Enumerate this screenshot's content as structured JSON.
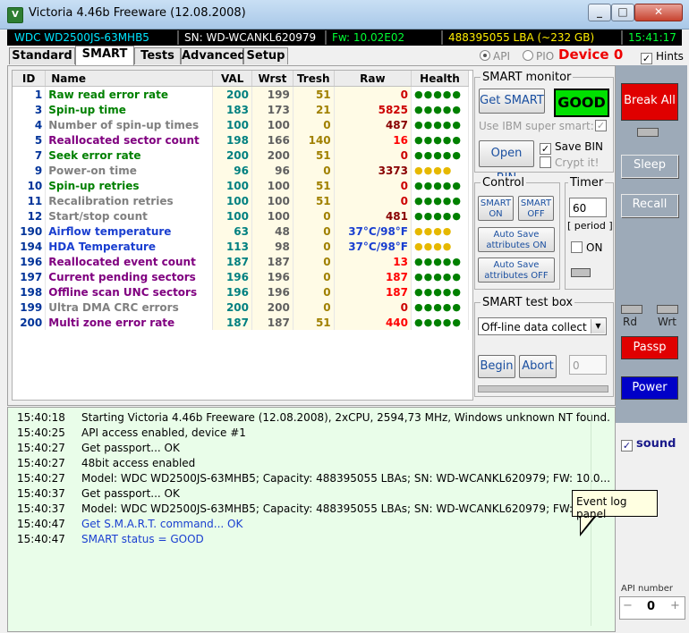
{
  "window": {
    "title": "Victoria 4.46b Freeware (12.08.2008)",
    "minimize": "_",
    "maximize": "□",
    "close": "✕"
  },
  "infobar": {
    "model": "WDC WD2500JS-63MHB5",
    "serial": "SN: WD-WCANKL620979",
    "firmware": "Fw: 10.02E02",
    "lba": "488395055 LBA (~232 GB)",
    "clock": "15:41:17",
    "colors": {
      "model": "#00e5ff",
      "serial": "#ffffff",
      "firmware": "#00ff33",
      "lba": "#ffee00",
      "clock": "#00ff33"
    }
  },
  "tabs": [
    "Standard",
    "SMART",
    "Tests",
    "Advanced",
    "Setup"
  ],
  "mode": {
    "api_label": "API",
    "pio_label": "PIO",
    "device": "Device 0",
    "hints_label": "Hints"
  },
  "smart_table": {
    "headers": [
      "ID",
      "Name",
      "VAL",
      "Wrst",
      "Tresh",
      "Raw",
      "Health"
    ],
    "rows": [
      {
        "id": "1",
        "name": "Raw read error rate",
        "val": "200",
        "wrst": "199",
        "tresh": "51",
        "raw": "0",
        "health": "●●●●●",
        "name_color": "#008000",
        "raw_color": "#cc0000",
        "health_color": "#008000"
      },
      {
        "id": "3",
        "name": "Spin-up time",
        "val": "183",
        "wrst": "173",
        "tresh": "21",
        "raw": "5825",
        "health": "●●●●●",
        "name_color": "#008000",
        "raw_color": "#cc0000",
        "health_color": "#008000"
      },
      {
        "id": "4",
        "name": "Number of spin-up times",
        "val": "100",
        "wrst": "100",
        "tresh": "0",
        "raw": "487",
        "health": "●●●●●",
        "name_color": "#808080",
        "raw_color": "#880000",
        "health_color": "#008000"
      },
      {
        "id": "5",
        "name": "Reallocated sector count",
        "val": "198",
        "wrst": "166",
        "tresh": "140",
        "raw": "16",
        "health": "●●●●●",
        "name_color": "#800080",
        "raw_color": "#ff0000",
        "health_color": "#008000"
      },
      {
        "id": "7",
        "name": "Seek error rate",
        "val": "200",
        "wrst": "200",
        "tresh": "51",
        "raw": "0",
        "health": "●●●●●",
        "name_color": "#008000",
        "raw_color": "#cc0000",
        "health_color": "#008000"
      },
      {
        "id": "9",
        "name": "Power-on time",
        "val": "96",
        "wrst": "96",
        "tresh": "0",
        "raw": "3373",
        "health": "●●●●",
        "name_color": "#808080",
        "raw_color": "#880000",
        "health_color": "#e6b800"
      },
      {
        "id": "10",
        "name": "Spin-up retries",
        "val": "100",
        "wrst": "100",
        "tresh": "51",
        "raw": "0",
        "health": "●●●●●",
        "name_color": "#008000",
        "raw_color": "#cc0000",
        "health_color": "#008000"
      },
      {
        "id": "11",
        "name": "Recalibration retries",
        "val": "100",
        "wrst": "100",
        "tresh": "51",
        "raw": "0",
        "health": "●●●●●",
        "name_color": "#808080",
        "raw_color": "#cc0000",
        "health_color": "#008000"
      },
      {
        "id": "12",
        "name": "Start/stop count",
        "val": "100",
        "wrst": "100",
        "tresh": "0",
        "raw": "481",
        "health": "●●●●●",
        "name_color": "#808080",
        "raw_color": "#880000",
        "health_color": "#008000"
      },
      {
        "id": "190",
        "name": "Airflow temperature",
        "val": "63",
        "wrst": "48",
        "tresh": "0",
        "raw": "37°C/98°F",
        "health": "●●●●",
        "name_color": "#1a3fd0",
        "raw_color": "#1a3fd0",
        "health_color": "#e6b800"
      },
      {
        "id": "194",
        "name": "HDA Temperature",
        "val": "113",
        "wrst": "98",
        "tresh": "0",
        "raw": "37°C/98°F",
        "health": "●●●●",
        "name_color": "#1a3fd0",
        "raw_color": "#1a3fd0",
        "health_color": "#e6b800"
      },
      {
        "id": "196",
        "name": "Reallocated event count",
        "val": "187",
        "wrst": "187",
        "tresh": "0",
        "raw": "13",
        "health": "●●●●●",
        "name_color": "#800080",
        "raw_color": "#ff0000",
        "health_color": "#008000"
      },
      {
        "id": "197",
        "name": "Current pending sectors",
        "val": "196",
        "wrst": "196",
        "tresh": "0",
        "raw": "187",
        "health": "●●●●●",
        "name_color": "#800080",
        "raw_color": "#ff0000",
        "health_color": "#008000"
      },
      {
        "id": "198",
        "name": "Offline scan UNC sectors",
        "val": "196",
        "wrst": "196",
        "tresh": "0",
        "raw": "187",
        "health": "●●●●●",
        "name_color": "#800080",
        "raw_color": "#ff0000",
        "health_color": "#008000"
      },
      {
        "id": "199",
        "name": "Ultra DMA CRC errors",
        "val": "200",
        "wrst": "200",
        "tresh": "0",
        "raw": "0",
        "health": "●●●●●",
        "name_color": "#808080",
        "raw_color": "#cc0000",
        "health_color": "#008000"
      },
      {
        "id": "200",
        "name": "Multi zone error rate",
        "val": "187",
        "wrst": "187",
        "tresh": "51",
        "raw": "440",
        "health": "●●●●●",
        "name_color": "#800080",
        "raw_color": "#ff0000",
        "health_color": "#008000"
      }
    ]
  },
  "smart_monitor": {
    "legend": "SMART monitor",
    "get_smart": "Get SMART",
    "status": "GOOD",
    "use_ibm": "Use IBM super smart:",
    "open_bin": "Open BIN",
    "save_bin": "Save BIN",
    "crypt": "Crypt it!"
  },
  "control": {
    "legend": "Control",
    "smart_on": "SMART\nON",
    "smart_off": "SMART\nOFF",
    "autosave_on": "Auto Save\nattributes ON",
    "autosave_off": "Auto Save\nattributes OFF"
  },
  "timer": {
    "legend": "Timer",
    "value": "60",
    "period": "[ period ]",
    "on_label": "ON"
  },
  "test_box": {
    "legend": "SMART test box",
    "selected": "Off-line data collect",
    "begin": "Begin",
    "abort": "Abort",
    "counter": "0"
  },
  "log": [
    {
      "time": "15:40:18",
      "msg": "Starting Victoria 4.46b Freeware (12.08.2008), 2xCPU, 2594,73 MHz, Windows unknown NT found.",
      "blue": false
    },
    {
      "time": "15:40:25",
      "msg": "API access enabled, device #1",
      "blue": false
    },
    {
      "time": "15:40:27",
      "msg": "Get passport... OK",
      "blue": false
    },
    {
      "time": "15:40:27",
      "msg": "48bit access enabled",
      "blue": false
    },
    {
      "time": "15:40:27",
      "msg": "Model: WDC WD2500JS-63MHB5; Capacity: 488395055 LBAs; SN: WD-WCANKL620979; FW: 10.0...",
      "blue": false
    },
    {
      "time": "15:40:37",
      "msg": "Get passport... OK",
      "blue": false
    },
    {
      "time": "15:40:37",
      "msg": "Model: WDC WD2500JS-63MHB5; Capacity: 488395055 LBAs; SN: WD-WCANKL620979; FW: 10.0...",
      "blue": false
    },
    {
      "time": "15:40:47",
      "msg": "Get S.M.A.R.T. command... OK",
      "blue": true
    },
    {
      "time": "15:40:47",
      "msg": "SMART status = GOOD",
      "blue": true
    }
  ],
  "tooltip": "Event log panel",
  "sidebar": {
    "break_all": "Break All",
    "sleep": "Sleep",
    "recall": "Recall",
    "rd": "Rd",
    "wrt": "Wrt",
    "passp": "Passp",
    "power": "Power",
    "sound": "sound",
    "api_number_label": "API number",
    "api_number": "0",
    "minus": "−",
    "plus": "+"
  }
}
